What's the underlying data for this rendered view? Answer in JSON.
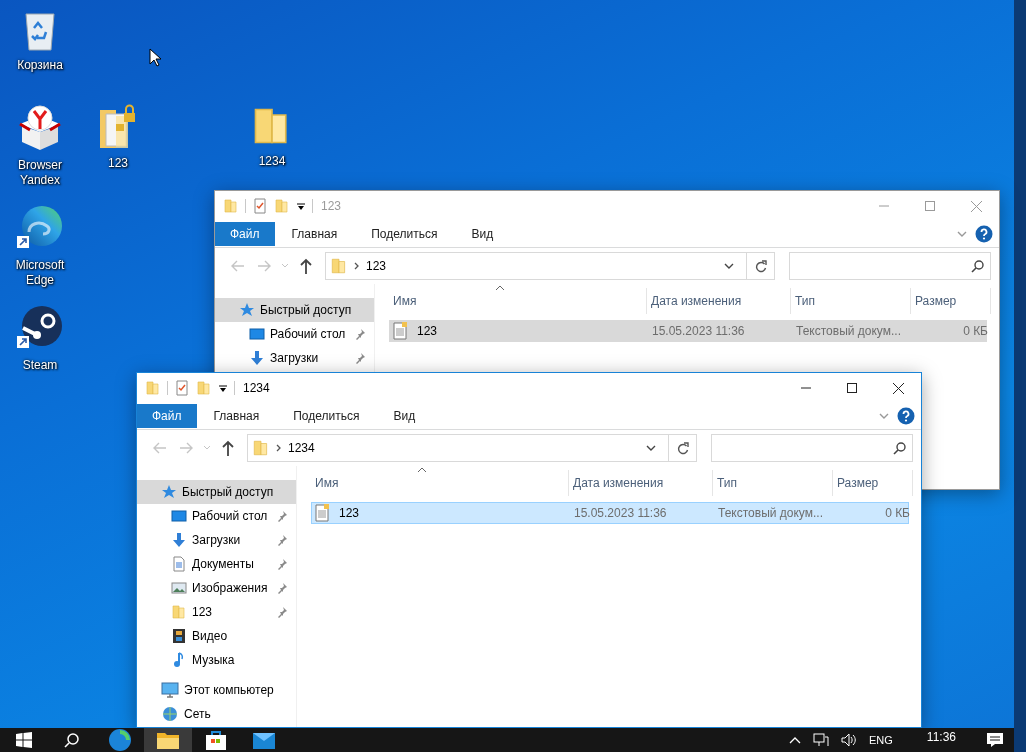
{
  "desktop_icons": [
    {
      "label": "Корзина",
      "kind": "recycle"
    },
    {
      "label": "Browser Yandex",
      "kind": "yandex"
    },
    {
      "label": "123",
      "kind": "locked_folder"
    },
    {
      "label": "1234",
      "kind": "folder"
    },
    {
      "label": "Microsoft Edge",
      "kind": "edge"
    },
    {
      "label": "Steam",
      "kind": "steam"
    }
  ],
  "windows": [
    {
      "title": "123",
      "active": false,
      "ribbon_tabs": [
        {
          "label": "Файл",
          "kind": "file"
        },
        {
          "label": "Главная",
          "kind": "tab"
        },
        {
          "label": "Поделиться",
          "kind": "tab"
        },
        {
          "label": "Вид",
          "kind": "tab"
        }
      ],
      "address": "123",
      "nav_items": [
        {
          "label": "Быстрый доступ",
          "kind": "quick",
          "selected": true,
          "pinned": false,
          "children": [
            {
              "label": "Рабочий стол",
              "kind": "desktop",
              "selected": false,
              "pinned": true
            },
            {
              "label": "Загрузки",
              "kind": "downloads",
              "selected": false,
              "pinned": true
            }
          ]
        }
      ],
      "columns": [
        "Имя",
        "Дата изменения",
        "Тип",
        "Размер"
      ],
      "rows": [
        {
          "name": "123",
          "date": "15.05.2023 11:36",
          "type": "Текстовый докум...",
          "size": "0 КБ",
          "selected": true
        }
      ]
    },
    {
      "title": "1234",
      "active": true,
      "ribbon_tabs": [
        {
          "label": "Файл",
          "kind": "file"
        },
        {
          "label": "Главная",
          "kind": "tab"
        },
        {
          "label": "Поделиться",
          "kind": "tab"
        },
        {
          "label": "Вид",
          "kind": "tab"
        }
      ],
      "address": "1234",
      "nav_items": [
        {
          "label": "Быстрый доступ",
          "kind": "quick",
          "selected": true,
          "pinned": false,
          "children": [
            {
              "label": "Рабочий стол",
              "kind": "desktop",
              "selected": false,
              "pinned": true
            },
            {
              "label": "Загрузки",
              "kind": "downloads",
              "selected": false,
              "pinned": true
            },
            {
              "label": "Документы",
              "kind": "documents",
              "selected": false,
              "pinned": true
            },
            {
              "label": "Изображения",
              "kind": "pictures",
              "selected": false,
              "pinned": true
            },
            {
              "label": "123",
              "kind": "folder",
              "selected": false,
              "pinned": true
            },
            {
              "label": "Видео",
              "kind": "video",
              "selected": false,
              "pinned": false
            },
            {
              "label": "Музыка",
              "kind": "music",
              "selected": false,
              "pinned": false
            }
          ]
        },
        {
          "label": "Этот компьютер",
          "kind": "pc",
          "selected": false,
          "pinned": false
        },
        {
          "label": "Сеть",
          "kind": "network",
          "selected": false,
          "pinned": false
        }
      ],
      "columns": [
        "Имя",
        "Дата изменения",
        "Тип",
        "Размер"
      ],
      "rows": [
        {
          "name": "123",
          "date": "15.05.2023 11:36",
          "type": "Текстовый докум...",
          "size": "0 КБ",
          "selected": true
        }
      ]
    }
  ],
  "taskbar": {
    "apps": [
      {
        "kind": "start",
        "active": false
      },
      {
        "kind": "search",
        "active": false
      },
      {
        "kind": "edge",
        "active": false
      },
      {
        "kind": "explorer",
        "active": true
      },
      {
        "kind": "store",
        "active": false
      },
      {
        "kind": "mail",
        "active": false
      }
    ],
    "language": "ENG",
    "time": "11:36"
  }
}
